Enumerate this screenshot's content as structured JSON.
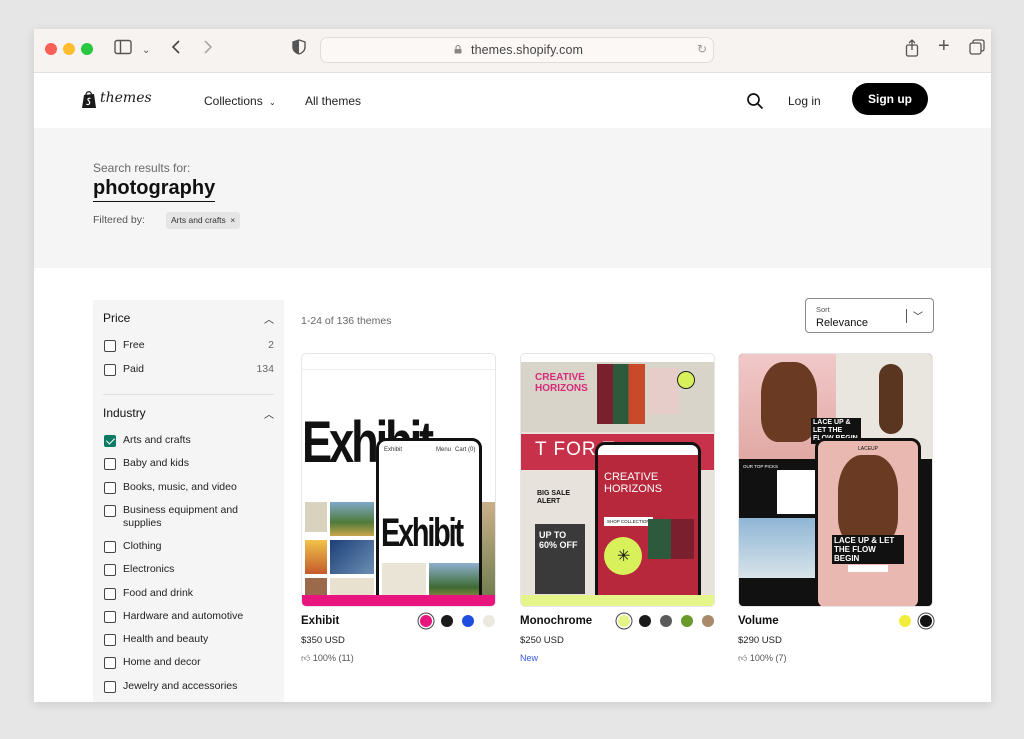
{
  "browser": {
    "url": "themes.shopify.com"
  },
  "header": {
    "logo_text": "themes",
    "nav": {
      "collections": "Collections",
      "all_themes": "All themes"
    },
    "login": "Log in",
    "signup": "Sign up"
  },
  "search": {
    "label": "Search results for:",
    "query": "photography",
    "filtered_label": "Filtered by:",
    "filter_chip": "Arts and crafts"
  },
  "filters": {
    "price": {
      "title": "Price",
      "options": [
        {
          "label": "Free",
          "count": "2",
          "checked": false
        },
        {
          "label": "Paid",
          "count": "134",
          "checked": false
        }
      ]
    },
    "industry": {
      "title": "Industry",
      "options": [
        {
          "label": "Arts and crafts",
          "checked": true
        },
        {
          "label": "Baby and kids",
          "checked": false
        },
        {
          "label": "Books, music, and video",
          "checked": false
        },
        {
          "label": "Business equipment and supplies",
          "checked": false
        },
        {
          "label": "Clothing",
          "checked": false
        },
        {
          "label": "Electronics",
          "checked": false
        },
        {
          "label": "Food and drink",
          "checked": false
        },
        {
          "label": "Hardware and automotive",
          "checked": false
        },
        {
          "label": "Health and beauty",
          "checked": false
        },
        {
          "label": "Home and decor",
          "checked": false
        },
        {
          "label": "Jewelry and accessories",
          "checked": false
        }
      ]
    }
  },
  "results": {
    "count_text": "1-24 of 136 themes",
    "sort_label": "Sort",
    "sort_value": "Relevance"
  },
  "themes": [
    {
      "name": "Exhibit",
      "price": "$350 USD",
      "rating": "100% (11)",
      "swatches": [
        "#e8157f",
        "#1a1a1a",
        "#1f4fe0",
        "#ece8e0"
      ],
      "thumb_text": {
        "hero": "Exhibit",
        "phone_title": "Exhibit",
        "menu": "Menu",
        "cart": "Cart (0)"
      }
    },
    {
      "name": "Monochrome",
      "price": "$250 USD",
      "badge": "New",
      "swatches": [
        "#e6f58a",
        "#1a1a1a",
        "#5a5a5a",
        "#6a9a2a",
        "#a88a6a"
      ],
      "thumb_text": {
        "hero": "CREATIVE HORIZONS",
        "banner": "T FOR T",
        "sale": "BIG SALE ALERT",
        "offer": "UP TO 60% OFF",
        "phone_title": "CREATIVE HORIZONS",
        "cta": "SHOP COLLECTION"
      }
    },
    {
      "name": "Volume",
      "price": "$290 USD",
      "rating": "100% (7)",
      "swatches": [
        "#f2ec3a",
        "#111111"
      ],
      "thumb_text": {
        "tagline": "LACE UP & LET THE FLOW BEGIN",
        "picks": "OUR TOP PICKS",
        "brand": "LACEUP",
        "phone_title": "LACE UP & LET THE FLOW BEGIN"
      }
    }
  ]
}
